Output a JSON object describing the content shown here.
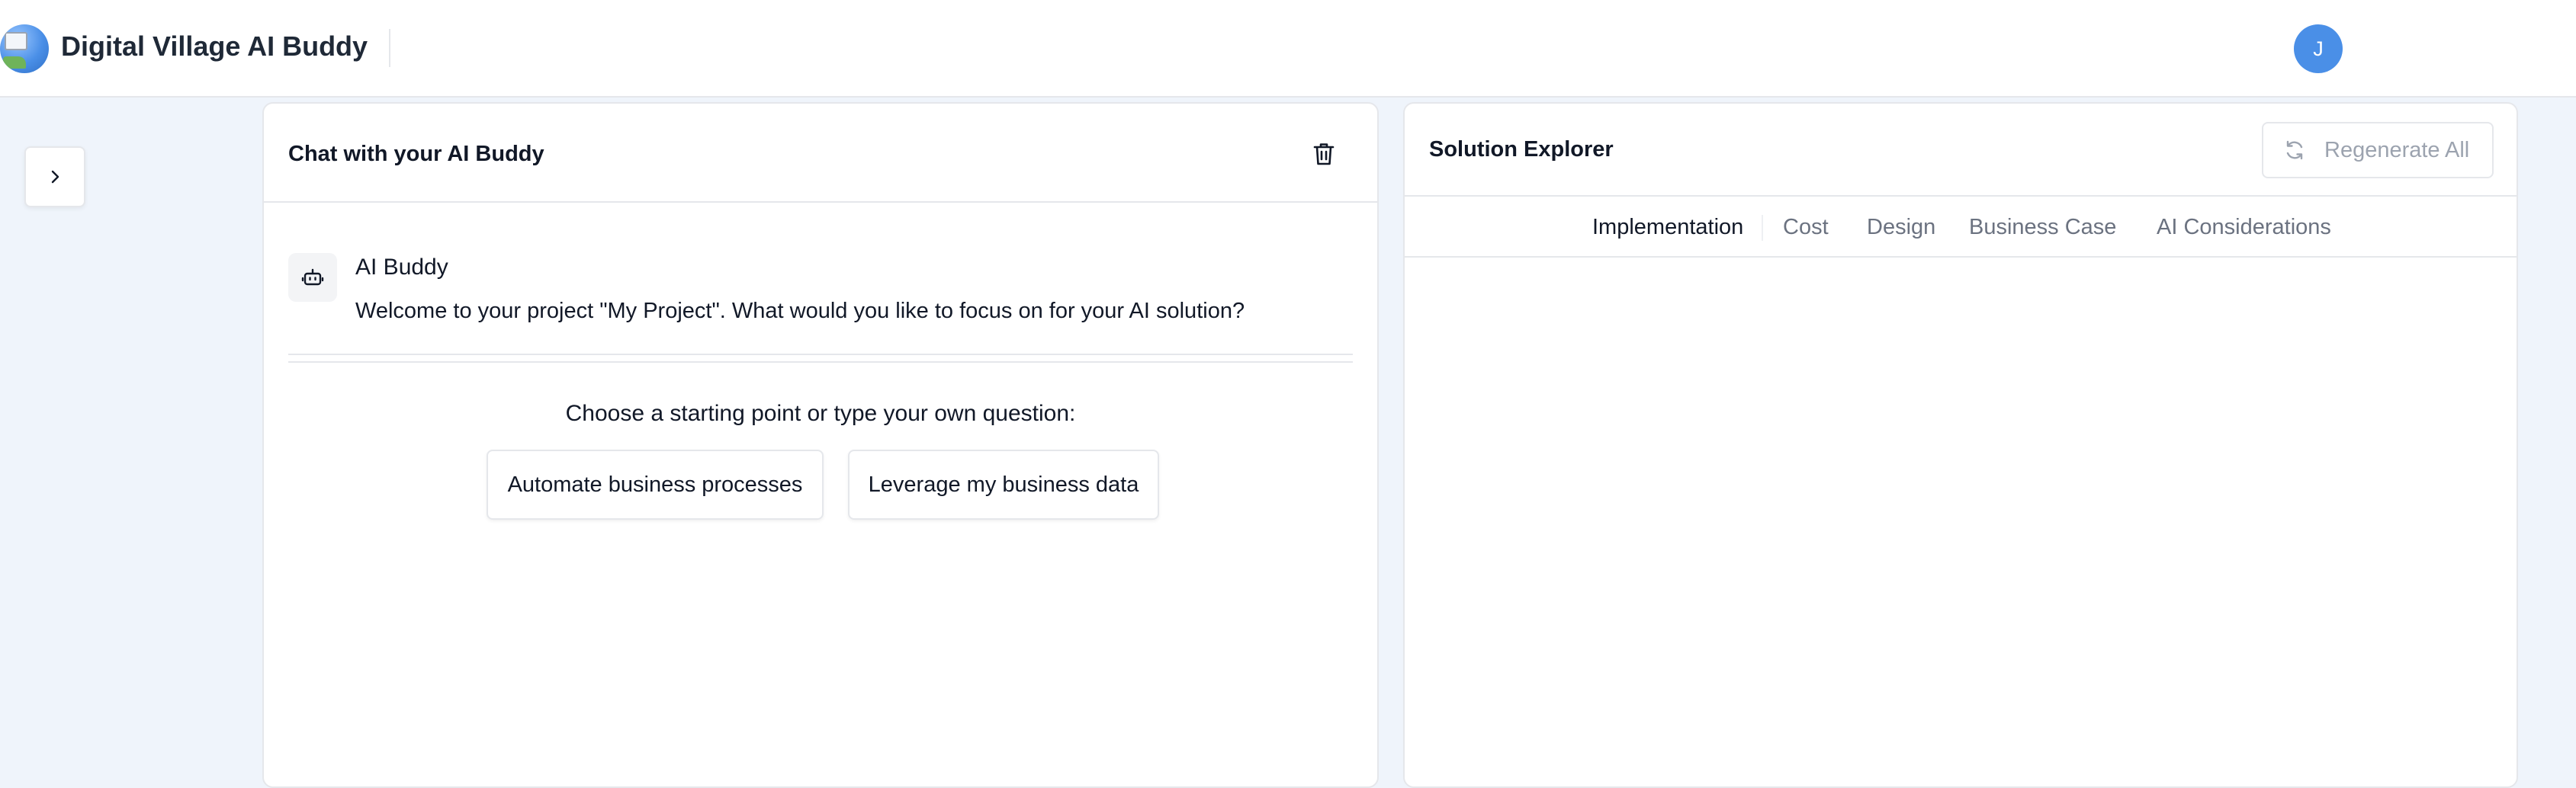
{
  "header": {
    "app_title": "Digital Village AI Buddy",
    "user_initial": "J"
  },
  "chat": {
    "title": "Chat with your AI Buddy",
    "messages": [
      {
        "author": "AI Buddy",
        "text": "Welcome to your project \"My Project\". What would you like to focus on for your AI solution?"
      }
    ],
    "prompt_heading": "Choose a starting point or type your own question:",
    "starters": [
      "Automate business processes",
      "Leverage my business data"
    ]
  },
  "explorer": {
    "title": "Solution Explorer",
    "regenerate_label": "Regenerate All",
    "tabs": [
      {
        "label": "Implementation",
        "active": true
      },
      {
        "label": "Cost",
        "active": false
      },
      {
        "label": "Design",
        "active": false
      },
      {
        "label": "Business Case",
        "active": false
      },
      {
        "label": "AI Considerations",
        "active": false
      }
    ]
  },
  "icons": {
    "sidebar_toggle": "chevron-right-icon",
    "clear_chat": "trash-icon",
    "bot": "robot-icon",
    "regenerate": "refresh-icon"
  },
  "colors": {
    "page_background": "#eff4fb",
    "accent": "#4a8fe7",
    "border": "#e5e7eb",
    "muted_text": "#6b7280"
  }
}
